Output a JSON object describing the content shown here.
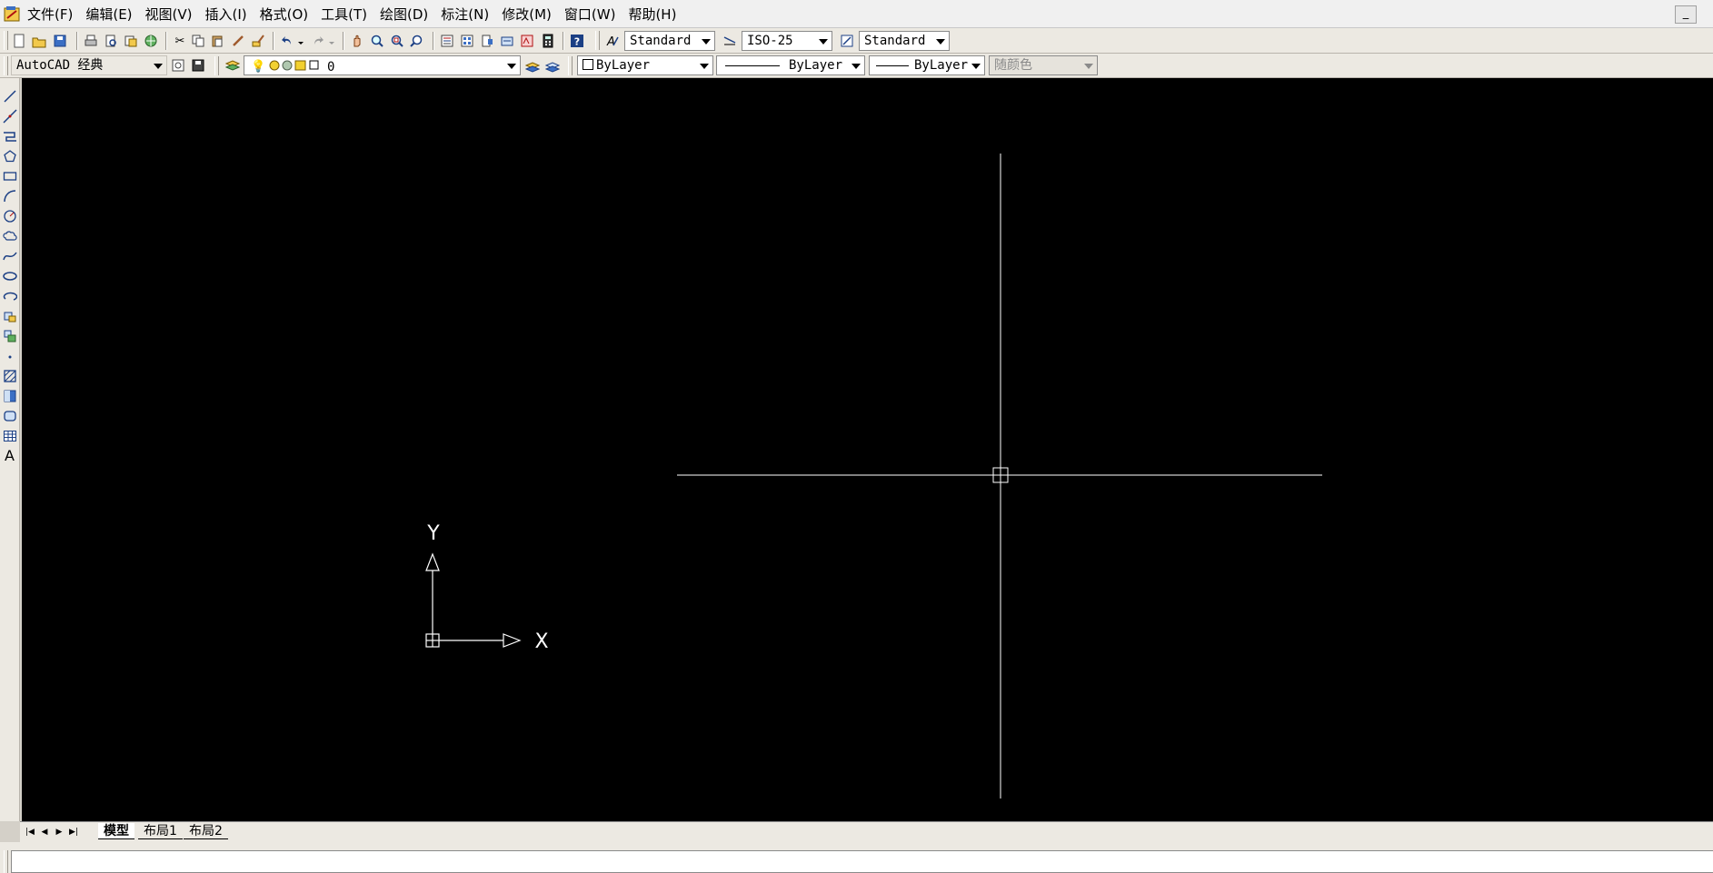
{
  "menubar": {
    "app_icon": "autocad-app-icon",
    "items": [
      "文件(F)",
      "编辑(E)",
      "视图(V)",
      "插入(I)",
      "格式(O)",
      "工具(T)",
      "绘图(D)",
      "标注(N)",
      "修改(M)",
      "窗口(W)",
      "帮助(H)"
    ],
    "minimize_label": "_"
  },
  "toolbar1": {
    "icons": [
      "new-icon",
      "open-icon",
      "save-icon",
      "plot-icon",
      "plot-preview-icon",
      "publish-icon",
      "etransmit-icon",
      "cut-icon",
      "copy-icon",
      "paste-icon",
      "brush-icon",
      "match-properties-icon",
      "undo-icon",
      "redo-icon",
      "pan-icon",
      "zoom-realtime-icon",
      "zoom-window-icon",
      "zoom-previous-icon",
      "properties-icon",
      "design-center-icon",
      "tool-palettes-icon",
      "sheet-set-icon",
      "markup-icon",
      "calculator-icon",
      "help-icon"
    ],
    "text_style": "Standard",
    "dim_style": "ISO-25",
    "table_style": "Standard"
  },
  "toolbar2": {
    "workspace": "AutoCAD 经典",
    "layer": "0",
    "color": "ByLayer",
    "linetype": "ByLayer",
    "lineweight": "ByLayer",
    "plotstyle": "随颜色"
  },
  "left_toolbar": {
    "icons": [
      "line-icon",
      "construction-line-icon",
      "polyline-icon",
      "polygon-icon",
      "rectangle-icon",
      "arc-icon",
      "circle-icon",
      "revision-cloud-icon",
      "spline-icon",
      "ellipse-icon",
      "ellipse-arc-icon",
      "insert-block-icon",
      "make-block-icon",
      "point-icon",
      "hatch-icon",
      "gradient-icon",
      "region-icon",
      "table-icon",
      "multiline-text-icon"
    ],
    "text_glyph": "A"
  },
  "canvas": {
    "background": "#000000",
    "ucs_x_label": "X",
    "ucs_y_label": "Y"
  },
  "tabs": {
    "items": [
      "模型",
      "布局1",
      "布局2"
    ],
    "active": 0
  },
  "command": {
    "value": ""
  }
}
